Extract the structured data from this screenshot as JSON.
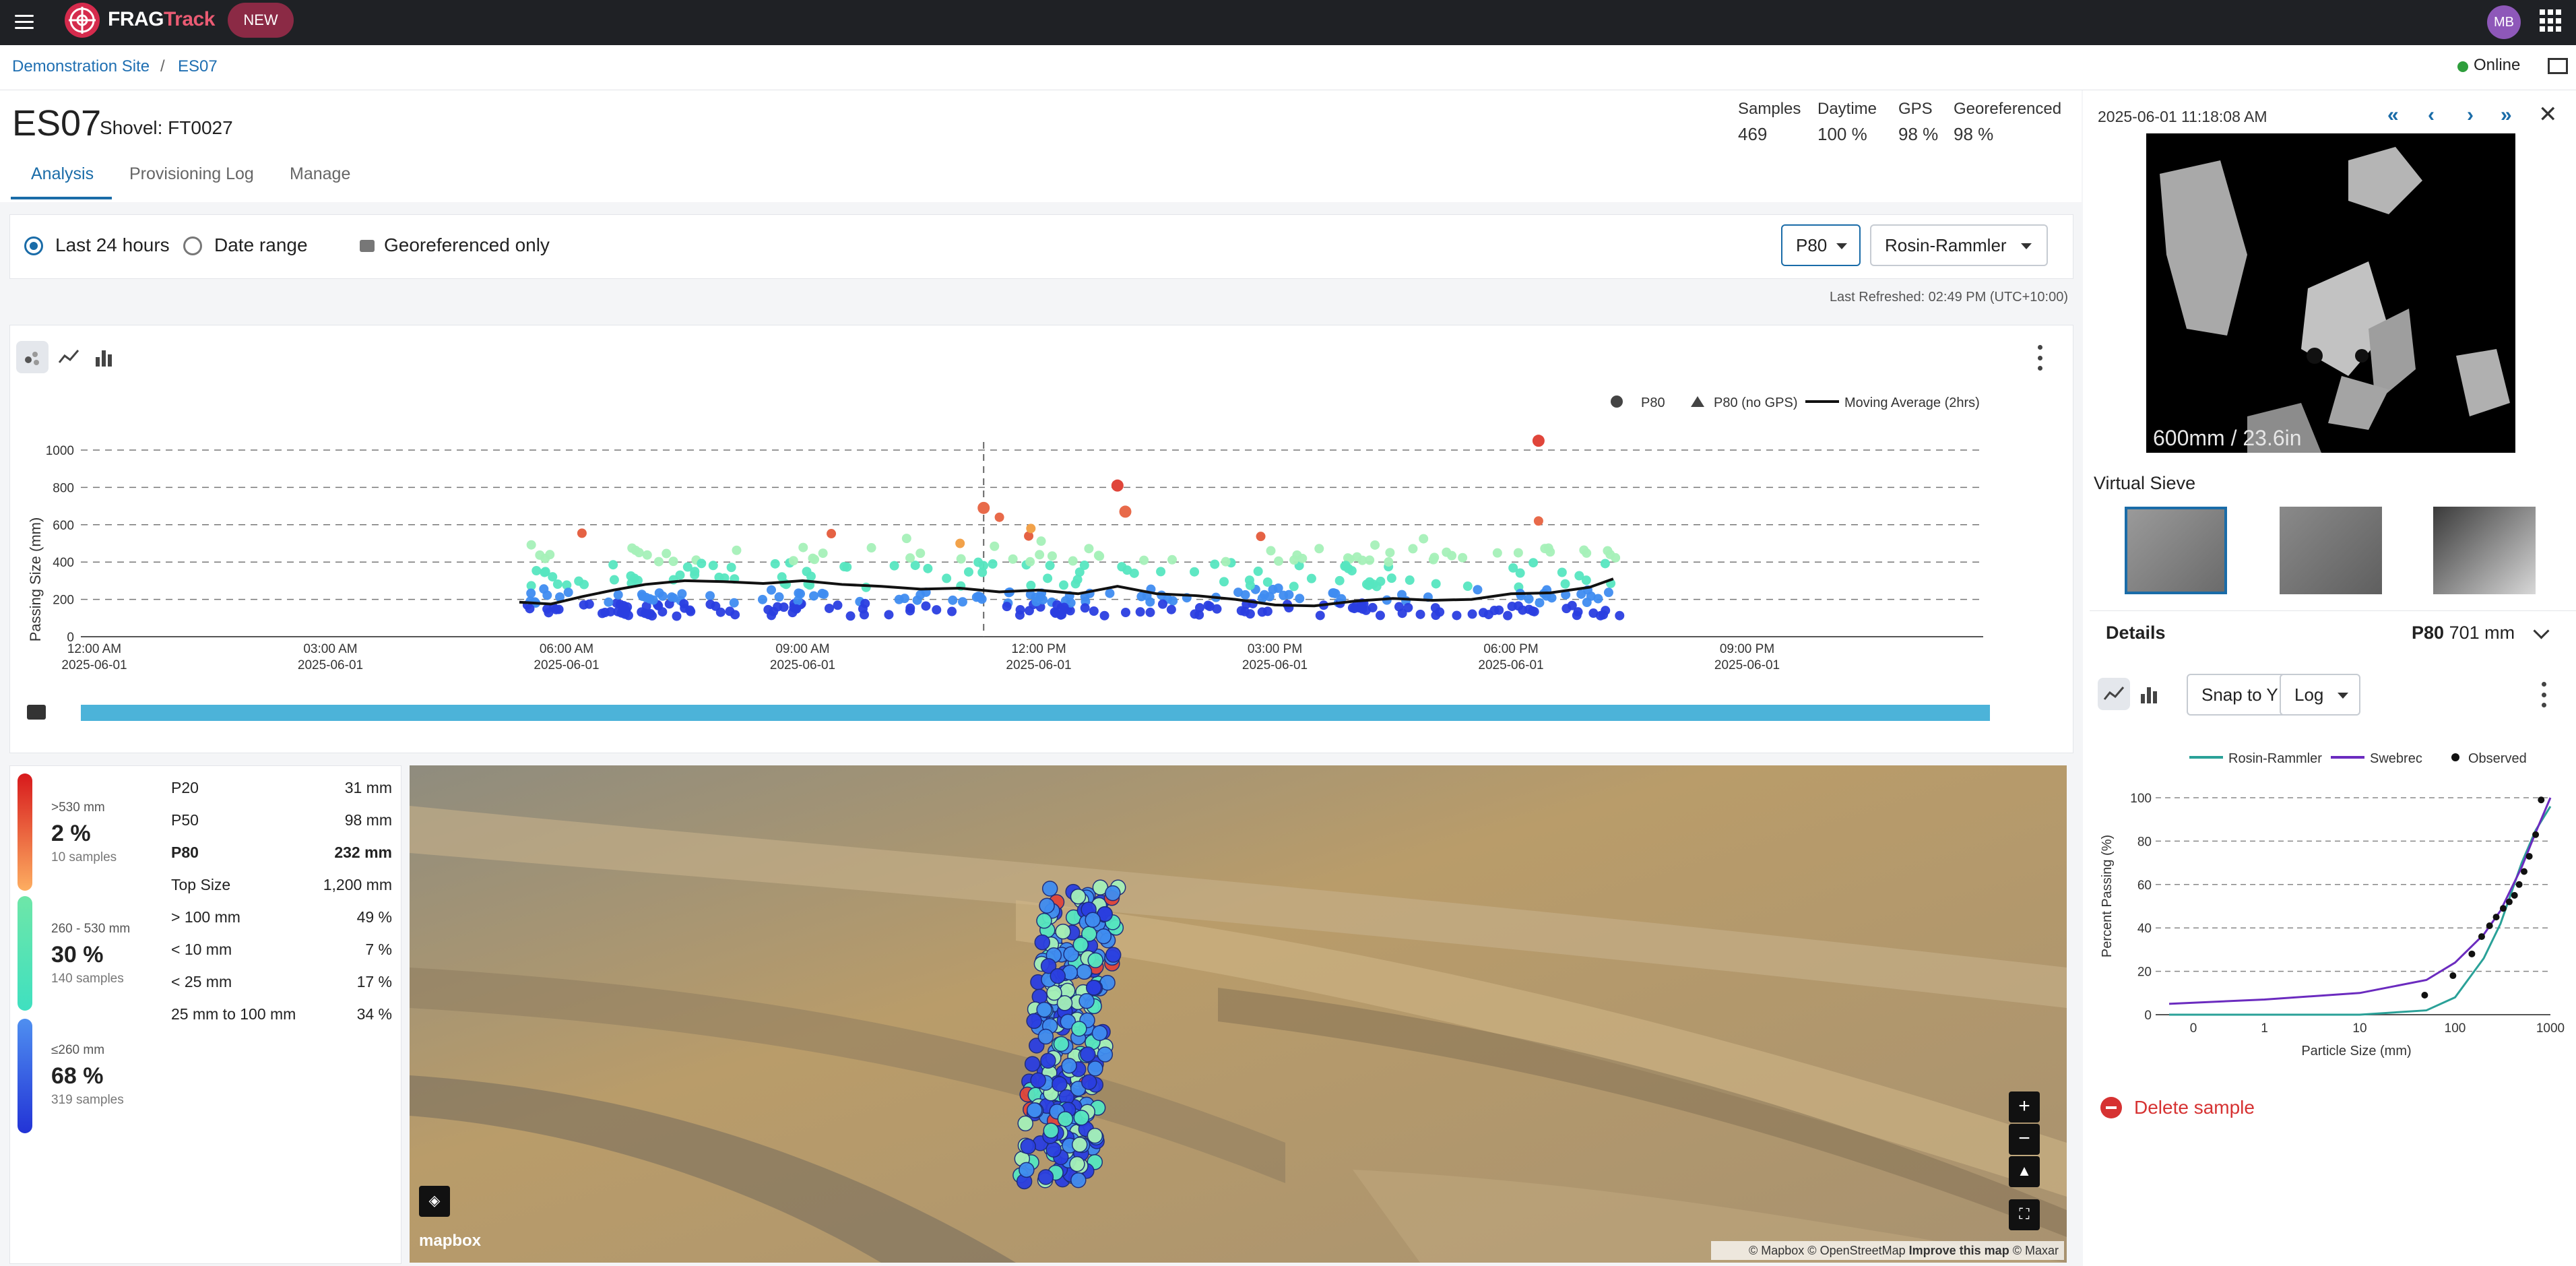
{
  "app": {
    "brand_part1": "FRAG",
    "brand_part2": "Track",
    "badge": "NEW",
    "user_initials": "MB"
  },
  "breadcrumb": {
    "site": "Demonstration Site",
    "separator": "/",
    "current": "ES07"
  },
  "status": {
    "online": "Online"
  },
  "header": {
    "title": "ES07",
    "subtitle": "Shovel: FT0027",
    "tabs": [
      "Analysis",
      "Provisioning Log",
      "Manage"
    ],
    "active_tab": "Analysis",
    "stats": [
      {
        "label": "Samples",
        "value": "469"
      },
      {
        "label": "Daytime",
        "value": "100 %"
      },
      {
        "label": "GPS",
        "value": "98 %"
      },
      {
        "label": "Georeferenced",
        "value": "98 %"
      }
    ]
  },
  "filters": {
    "last24": "Last 24 hours",
    "date_range": "Date range",
    "geo_only": "Georeferenced only",
    "metric_select": "P80",
    "model_select": "Rosin-Rammler",
    "selected_range": "Last 24 hours"
  },
  "refreshed": "Last Refreshed: 02:49 PM (UTC+10:00)",
  "colors": {
    "accent": "#1a6ca8",
    "brand": "#d52b4d",
    "online": "#2e9e3c",
    "delete": "#d63232",
    "timebar": "#4cb3d9"
  },
  "chart_data": [
    {
      "type": "scatter",
      "ylabel": "Passing Size (mm)",
      "yticks": [
        "1000",
        "800",
        "600",
        "400",
        "200",
        "0"
      ],
      "ylim": [
        0,
        1000
      ],
      "grid": true,
      "legend_position": "top-right",
      "legend": [
        "P80",
        "P80 (no GPS)",
        "Moving Average (2hrs)"
      ],
      "x_ticks": [
        {
          "time": "12:00 AM",
          "date": "2025-06-01"
        },
        {
          "time": "03:00 AM",
          "date": "2025-06-01"
        },
        {
          "time": "06:00 AM",
          "date": "2025-06-01"
        },
        {
          "time": "09:00 AM",
          "date": "2025-06-01"
        },
        {
          "time": "12:00 PM",
          "date": "2025-06-01"
        },
        {
          "time": "03:00 PM",
          "date": "2025-06-01"
        },
        {
          "time": "06:00 PM",
          "date": "2025-06-01"
        },
        {
          "time": "09:00 PM",
          "date": "2025-06-01"
        }
      ],
      "x_hours_start": 0,
      "x_hours_end": 24,
      "selected_time_hours": 11.3,
      "moving_average": {
        "x_hours": [
          5.4,
          5.8,
          6.2,
          6.6,
          7.0,
          7.5,
          8.0,
          8.5,
          9.0,
          9.5,
          10.0,
          10.5,
          11.0,
          11.5,
          12.0,
          12.5,
          13.0,
          13.5,
          14.0,
          14.5,
          15.0,
          15.5,
          16.0,
          16.5,
          17.0,
          17.5,
          18.0,
          18.5,
          19.0,
          19.3
        ],
        "values": [
          185,
          175,
          215,
          250,
          280,
          300,
          295,
          285,
          300,
          280,
          270,
          255,
          260,
          240,
          250,
          230,
          270,
          230,
          220,
          200,
          170,
          165,
          190,
          205,
          195,
          200,
          230,
          235,
          265,
          310
        ]
      },
      "highlights": [
        {
          "x_hours": 11.3,
          "value": 690
        },
        {
          "x_hours": 11.5,
          "value": 640
        },
        {
          "x_hours": 11.9,
          "value": 580
        },
        {
          "x_hours": 13.0,
          "value": 810
        },
        {
          "x_hours": 13.1,
          "value": 670
        },
        {
          "x_hours": 18.35,
          "value": 1050
        },
        {
          "x_hours": 18.35,
          "value": 620
        },
        {
          "x_hours": 11.0,
          "value": 500
        }
      ]
    },
    {
      "type": "line",
      "xlabel": "Particle Size (mm)",
      "ylabel": "Percent Passing (%)",
      "x_scale": "log",
      "xticks": [
        "0",
        "1",
        "10",
        "100",
        "1000"
      ],
      "yticks": [
        "100",
        "80",
        "60",
        "40",
        "20",
        "0"
      ],
      "ylim": [
        0,
        100
      ],
      "legend": [
        "Rosin-Rammler",
        "Swebrec",
        "Observed"
      ],
      "series": [
        {
          "name": "Rosin-Rammler",
          "color": "#2aa198",
          "x": [
            0.1,
            1,
            10,
            50,
            100,
            200,
            300,
            500,
            700,
            1000
          ],
          "y": [
            0,
            0,
            0,
            2,
            8,
            26,
            42,
            70,
            85,
            96
          ]
        },
        {
          "name": "Swebrec",
          "color": "#6b2bbf",
          "x": [
            0.1,
            1,
            10,
            50,
            100,
            200,
            300,
            500,
            700,
            1000
          ],
          "y": [
            5,
            7,
            10,
            16,
            24,
            37,
            48,
            68,
            84,
            100
          ]
        },
        {
          "name": "Observed",
          "color": "#111111",
          "x": [
            48,
            95,
            150,
            190,
            230,
            270,
            320,
            370,
            420,
            470,
            530,
            600,
            700,
            800
          ],
          "y": [
            9,
            18,
            28,
            36,
            41,
            45,
            49,
            52,
            55,
            60,
            66,
            73,
            83,
            99
          ]
        }
      ]
    }
  ],
  "details": {
    "title": "Details",
    "p80_label": "P80",
    "p80_value": "701 mm",
    "snap_select": "Snap to Y",
    "scale_select": "Log",
    "delete": "Delete sample"
  },
  "summary": {
    "bands": [
      {
        "label": ">530 mm",
        "pct": "2 %",
        "count": "10 samples",
        "gradient": "linear-gradient(#d7191c,#fdae61)"
      },
      {
        "label": "260 - 530 mm",
        "pct": "30 %",
        "count": "140 samples",
        "gradient": "linear-gradient(#6ee6a8,#3fe0c0)"
      },
      {
        "label": "≤260 mm",
        "pct": "68 %",
        "count": "319 samples",
        "gradient": "linear-gradient(#4f8ff0,#2233d6)"
      }
    ],
    "metrics": [
      {
        "label": "P20",
        "value": "31 mm"
      },
      {
        "label": "P50",
        "value": "98 mm"
      },
      {
        "label": "P80",
        "value": "232 mm"
      },
      {
        "label": "Top Size",
        "value": "1,200 mm"
      },
      {
        "label": "> 100 mm",
        "value": "49 %"
      },
      {
        "label": "< 10 mm",
        "value": "7 %"
      },
      {
        "label": "< 25 mm",
        "value": "17 %"
      },
      {
        "label": "25 mm to 100 mm",
        "value": "34 %"
      }
    ]
  },
  "sample": {
    "timestamp": "2025-06-01 11:18:08 AM",
    "photo_caption": "600mm / 23.6in",
    "virtual_sieve_title": "Virtual Sieve"
  },
  "map": {
    "logo": "mapbox",
    "attrib_a": "© Mapbox © OpenStreetMap",
    "attrib_b": "Improve this map",
    "attrib_c": "© Maxar"
  },
  "icons": [
    "menu-icon",
    "frag-logo-icon",
    "apps-icon",
    "map-book-icon",
    "scatter-icon",
    "line-icon",
    "bar-icon",
    "more-icon",
    "camera-icon",
    "layers-icon",
    "zoom-in-icon",
    "zoom-out-icon",
    "compass-icon",
    "fullscreen-icon",
    "first-icon",
    "prev-icon",
    "next-icon",
    "last-icon",
    "close-icon",
    "chevron-down-icon",
    "delete-icon"
  ]
}
